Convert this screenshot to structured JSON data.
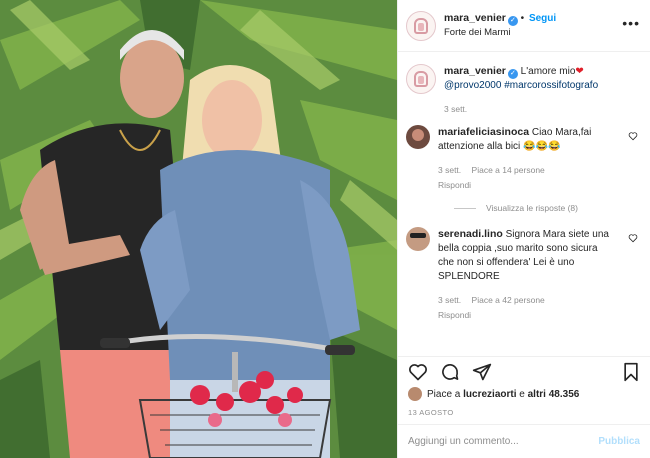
{
  "header": {
    "username": "mara_venier",
    "follow_label": "Segui",
    "location": "Forte dei Marmi",
    "more_glyph": "•••"
  },
  "caption": {
    "username": "mara_venier",
    "text": "L'amore mio",
    "heart": "❤",
    "mention": "@provo2000",
    "hashtag": "#marcorossifotografo",
    "time": "3 sett."
  },
  "comments": [
    {
      "username": "mariafeliciasinoca",
      "text": "Ciao Mara,fai attenzione alla bici",
      "emojis": "😂😂😂",
      "time": "3 sett.",
      "likes": "Piace a 14 persone",
      "reply": "Rispondi"
    },
    {
      "username": "serenadi.lino",
      "text": "Signora Mara siete una bella coppia ,suo marito sono sicura che non si offendera' Lei è uno SPLENDORE",
      "time": "3 sett.",
      "likes": "Piace a 42 persone",
      "reply": "Rispondi"
    }
  ],
  "view_replies": "Visualizza le risposte (8)",
  "likes": {
    "prefix": "Piace a ",
    "user": "lucreziaorti",
    "middle": " e ",
    "others": "altri 48.356"
  },
  "post_date": "13 AGOSTO",
  "comment_input": {
    "placeholder": "Aggiungi un commento...",
    "publish_label": "Pubblica"
  },
  "icons": {
    "heart": "heart-icon",
    "comment": "comment-icon",
    "share": "share-icon",
    "bookmark": "bookmark-icon",
    "verified": "verified-badge-icon"
  },
  "colors": {
    "link": "#0095f6",
    "verified": "#3897f0",
    "muted": "#8e8e8e",
    "publish_disabled": "#b2dffc"
  }
}
